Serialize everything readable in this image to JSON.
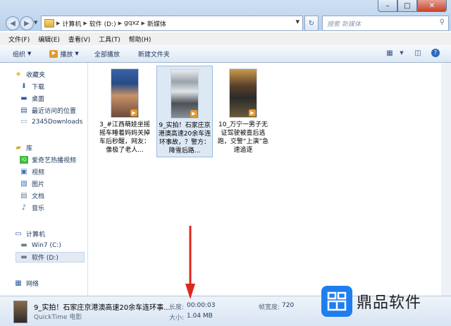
{
  "window": {
    "min": "–",
    "max": "□",
    "close": "✕"
  },
  "address": {
    "crumbs": [
      "计算机",
      "软件 (D:)",
      "gqxz",
      "新媒体"
    ]
  },
  "search": {
    "placeholder": "搜索 新媒体"
  },
  "menu": [
    "文件(F)",
    "编辑(E)",
    "查看(V)",
    "工具(T)",
    "帮助(H)"
  ],
  "toolbar": {
    "organize": "组织",
    "play": "播放",
    "play_all": "全部播放",
    "new_folder": "新建文件夹"
  },
  "nav": {
    "favorites": "收藏夹",
    "downloads": "下载",
    "desktop": "桌面",
    "recent": "最近访问的位置",
    "folder_2345": "2345Downloads",
    "library": "库",
    "iqiyi": "爱奇艺热播视频",
    "video": "视频",
    "pictures": "图片",
    "docs": "文档",
    "music": "音乐",
    "computer": "计算机",
    "c_drive": "Win7 (C:)",
    "d_drive": "软件 (D:)",
    "network": "网络"
  },
  "files": [
    {
      "name": "3_#江西萌娃坐摇摇车睡着妈妈关掉车后秒醒，网友：像极了老人...",
      "selected": false
    },
    {
      "name": "9_实拍！石家庄京港澳高速20余车连环事故，？警方：降雪后路...",
      "selected": true
    },
    {
      "name": "10_万宁一男子无证驾驶被查后逃跑，交警“上演”急速追逐",
      "selected": false
    }
  ],
  "details": {
    "title": "9_实拍！石家庄京港澳高速20余车连环事...",
    "type": "QuickTime 电影",
    "length_label": "长度:",
    "length": "00:00:03",
    "size_label": "大小:",
    "size": "1.04 MB",
    "framewidth_label": "帧宽度:",
    "framewidth": "720"
  },
  "watermark": {
    "text": "鼎品软件"
  },
  "colors": {
    "accent": "#1e7ef0",
    "arrow": "#e0271d"
  }
}
